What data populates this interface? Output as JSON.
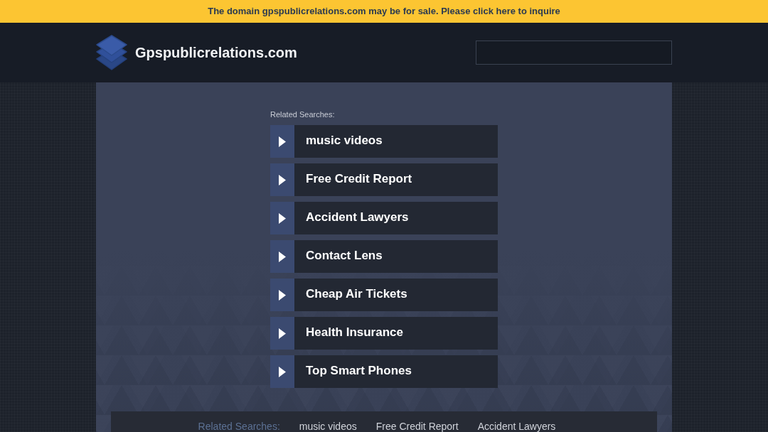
{
  "banner": {
    "text": "The domain gpspublicrelations.com may be for sale. Please click here to inquire"
  },
  "header": {
    "site_title": "Gpspublicrelations.com"
  },
  "related_searches": {
    "heading": "Related Searches:",
    "links": [
      "music videos",
      "Free Credit Report",
      "Accident Lawyers",
      "Contact Lens",
      "Cheap Air Tickets",
      "Health Insurance",
      "Top Smart Phones"
    ]
  },
  "footer": {
    "heading": "Related Searches:",
    "links": [
      "music videos",
      "Free Credit Report",
      "Accident Lawyers"
    ]
  }
}
